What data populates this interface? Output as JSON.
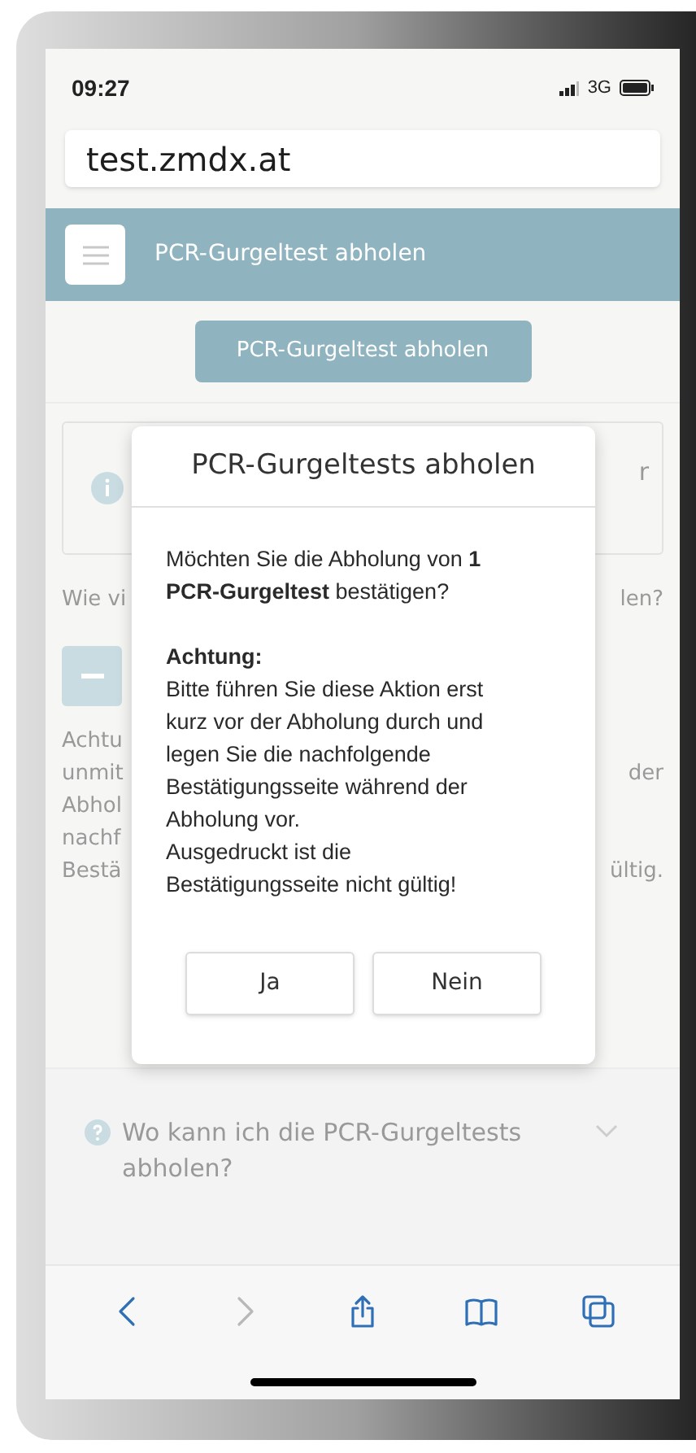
{
  "status_bar": {
    "time": "09:27",
    "network": "3G"
  },
  "address_bar": {
    "url": "test.zmdx.at"
  },
  "header": {
    "title": "PCR-Gurgeltest abholen"
  },
  "primary_button": {
    "label": "PCR-Gurgeltest abholen"
  },
  "info_box": {
    "visible_right": "r"
  },
  "question": {
    "visible_left": "Wie vi",
    "visible_right": "len?"
  },
  "notice_lines": [
    {
      "left": "Achtu"
    },
    {
      "left": "unmit",
      "right": "der"
    },
    {
      "left": "Abhol"
    },
    {
      "left": "nachf"
    },
    {
      "left": "Bestä",
      "right": "ültig."
    }
  ],
  "dialog": {
    "title": "PCR-Gurgeltests abholen",
    "message": "Möchten Sie die Abholung von **1** **PCR-Gurgeltest** bestätigen?",
    "warning_title": "Achtung:",
    "warning_paragraphs": [
      "Bitte führen Sie diese Aktion erst kurz vor der Abholung durch und legen Sie die nachfolgende Bestätigungsseite während der Abholung vor.",
      "Ausgedruckt ist die Bestätigungsseite nicht gültig!"
    ],
    "buttons": [
      "Ja",
      "Nein"
    ]
  },
  "faq": [
    {
      "question": "Wo kann ich die PCR-Gurgeltests abholen?",
      "expanded": false
    }
  ],
  "toolbar": [
    {
      "kind": "back",
      "disabled": false
    },
    {
      "kind": "forward",
      "disabled": true
    },
    {
      "kind": "share",
      "disabled": false
    },
    {
      "kind": "bookmarks",
      "disabled": false
    },
    {
      "kind": "tabs",
      "disabled": false
    }
  ]
}
